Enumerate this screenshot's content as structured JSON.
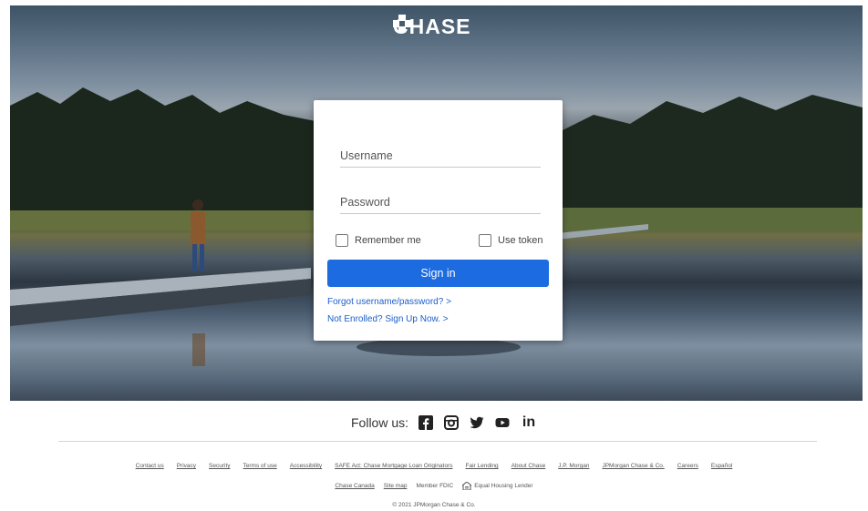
{
  "brand": {
    "logo_text": "CHASE",
    "logo_icon": "chase-octagon-logo-icon",
    "accent": "#1c6be0"
  },
  "login": {
    "username_placeholder": "Username",
    "password_placeholder": "Password",
    "remember_label": "Remember me",
    "token_label": "Use token",
    "signin_label": "Sign in",
    "forgot_link": "Forgot username/password? >",
    "enroll_link": "Not Enrolled? Sign Up Now. >"
  },
  "follow": {
    "label": "Follow us:",
    "icons": [
      "facebook-icon",
      "instagram-icon",
      "twitter-icon",
      "youtube-icon",
      "linkedin-icon"
    ],
    "linkedin_text": "in"
  },
  "footer": {
    "links_row1": [
      "Contact us",
      "Privacy",
      "Security",
      "Terms of use",
      "Accessibility",
      "SAFE Act: Chase Mortgage Loan Originators",
      "Fair Lending",
      "About Chase",
      "J.P. Morgan",
      "JPMorgan Chase & Co.",
      "Careers",
      "Español"
    ],
    "chase_canada": "Chase Canada",
    "site_map": "Site map",
    "member_fdic": "Member FDIC",
    "equal_housing": "Equal Housing Lender",
    "copyright": "© 2021 JPMorgan Chase & Co."
  }
}
